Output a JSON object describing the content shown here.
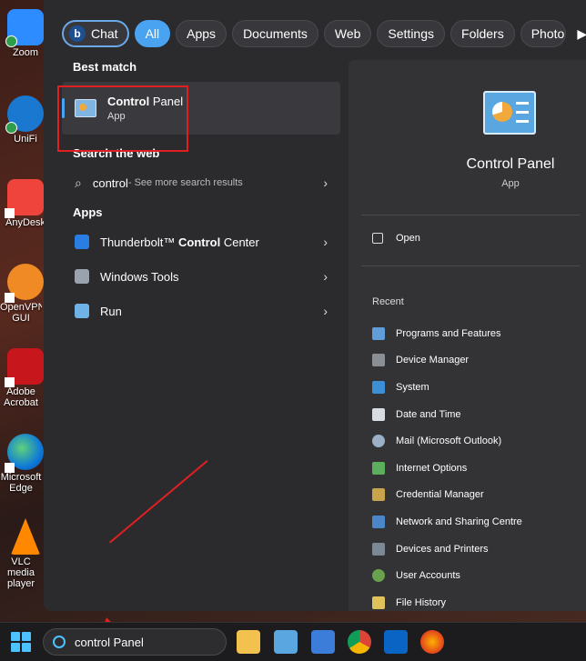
{
  "desktop": {
    "icons": [
      {
        "label": "Zoom",
        "name": "zoom-desktop-icon"
      },
      {
        "label": "UniFi",
        "name": "unifi-desktop-icon"
      },
      {
        "label": "AnyDesk",
        "name": "anydesk-desktop-icon"
      },
      {
        "label": "OpenVPN GUI",
        "name": "openvpn-desktop-icon"
      },
      {
        "label": "Adobe Acrobat",
        "name": "acrobat-desktop-icon"
      },
      {
        "label": "Microsoft Edge",
        "name": "edge-desktop-icon"
      },
      {
        "label": "VLC media player",
        "name": "vlc-desktop-icon"
      }
    ]
  },
  "filters": {
    "chat": "Chat",
    "all": "All",
    "apps": "Apps",
    "documents": "Documents",
    "web": "Web",
    "settings": "Settings",
    "folders": "Folders",
    "photos": "Photos"
  },
  "left": {
    "best_match_title": "Best match",
    "best_match": {
      "name_bold": "Control",
      "name_rest": " Panel",
      "type": "App"
    },
    "web_title": "Search the web",
    "web_query": "control",
    "web_hint": " - See more search results",
    "apps_title": "Apps",
    "apps": [
      {
        "pre": "Thunderbolt™ ",
        "bold": "Control",
        "post": " Center"
      },
      {
        "pre": "Windows Tools",
        "bold": "",
        "post": ""
      },
      {
        "pre": "Run",
        "bold": "",
        "post": ""
      }
    ]
  },
  "right": {
    "title": "Control Panel",
    "subtitle": "App",
    "open_label": "Open",
    "recent_title": "Recent",
    "recent": [
      "Programs and Features",
      "Device Manager",
      "System",
      "Date and Time",
      "Mail (Microsoft Outlook)",
      "Internet Options",
      "Credential Manager",
      "Network and Sharing Centre",
      "Devices and Printers",
      "User Accounts",
      "File History"
    ]
  },
  "taskbar": {
    "search_value": "control Panel"
  },
  "colors": {
    "accent": "#4aa3f0",
    "annotation": "#e02020"
  }
}
